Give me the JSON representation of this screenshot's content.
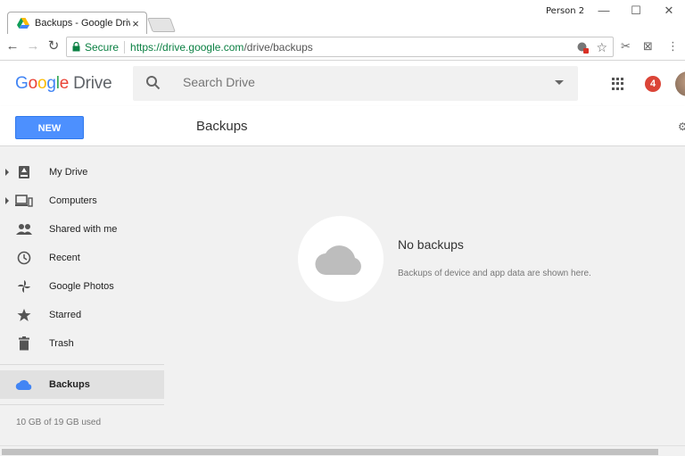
{
  "browser": {
    "tab_title": "Backups - Google Drive",
    "tab_close": "×",
    "profile": "Person 2",
    "window_controls": {
      "minimize": "—",
      "maximize": "☐",
      "close": "✕"
    },
    "secure_label": "Secure",
    "url_host": "https://drive.google.com",
    "url_path": "/drive/backups"
  },
  "header": {
    "logo_letters": [
      "G",
      "o",
      "o",
      "g",
      "l",
      "e"
    ],
    "logo_product": "Drive",
    "search_placeholder": "Search Drive",
    "notification_count": "4"
  },
  "toolbar": {
    "new_label": "NEW",
    "page_title": "Backups"
  },
  "sidebar": {
    "items": [
      {
        "label": "My Drive",
        "icon": "drive-icon",
        "expandable": true
      },
      {
        "label": "Computers",
        "icon": "computers-icon",
        "expandable": true
      },
      {
        "label": "Shared with me",
        "icon": "people-icon",
        "expandable": false
      },
      {
        "label": "Recent",
        "icon": "clock-icon",
        "expandable": false
      },
      {
        "label": "Google Photos",
        "icon": "pinwheel-icon",
        "expandable": false
      },
      {
        "label": "Starred",
        "icon": "star-icon",
        "expandable": false
      },
      {
        "label": "Trash",
        "icon": "trash-icon",
        "expandable": false
      },
      {
        "label": "Backups",
        "icon": "cloud-icon",
        "expandable": false,
        "active": true
      }
    ],
    "storage": "10 GB of 19 GB used"
  },
  "empty_state": {
    "title": "No backups",
    "description": "Backups of device and app data are shown here."
  },
  "colors": {
    "accent": "#4d90fe",
    "secure_green": "#0b8043",
    "badge_red": "#db4437",
    "backup_blue": "#4285f4"
  }
}
